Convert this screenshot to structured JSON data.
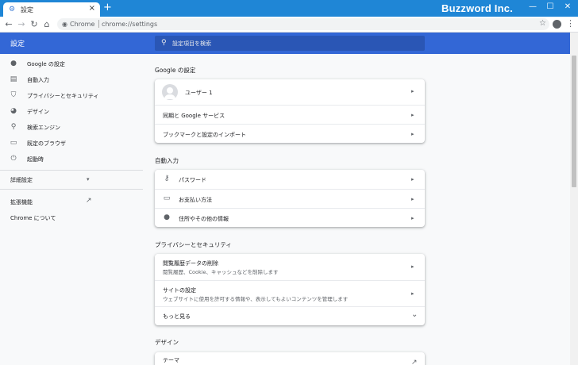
{
  "browser": {
    "tab_title": "設定",
    "tab_icon": "gear-icon",
    "tab_close": "×",
    "new_tab": "+",
    "brand": "Buzzword Inc.",
    "window_controls": [
      "—",
      "☐",
      "✕"
    ],
    "nav": {
      "back": "←",
      "forward": "→",
      "reload": "↻",
      "home": "⌂"
    },
    "omnibox": {
      "site_label": "Chrome",
      "url": "chrome://settings"
    },
    "star": "☆",
    "menu": "⋮"
  },
  "header": {
    "title": "設定",
    "search_placeholder": "設定項目を検索",
    "search_icon": "⚲"
  },
  "sidebar": {
    "items": [
      {
        "label": "Google の設定",
        "icon": "person-icon",
        "glyph": "●"
      },
      {
        "label": "自動入力",
        "icon": "clipboard-icon",
        "glyph": "▤"
      },
      {
        "label": "プライバシーとセキュリティ",
        "icon": "shield-icon",
        "glyph": "⛉"
      },
      {
        "label": "デザイン",
        "icon": "palette-icon",
        "glyph": "◕"
      },
      {
        "label": "検索エンジン",
        "icon": "search-icon",
        "glyph": "⚲"
      },
      {
        "label": "既定のブラウザ",
        "icon": "browser-icon",
        "glyph": "▭"
      },
      {
        "label": "起動時",
        "icon": "power-icon",
        "glyph": "⏻"
      }
    ],
    "advanced": "詳細設定",
    "advanced_caret": "▾",
    "extensions": "拡張機能",
    "extensions_icon": "↗",
    "about": "Chrome について"
  },
  "sections": {
    "google": {
      "title": "Google の設定",
      "user": "ユーザー 1",
      "sync": "同期と Google サービス",
      "import": "ブックマークと設定のインポート"
    },
    "autofill": {
      "title": "自動入力",
      "passwords": "パスワード",
      "passwords_glyph": "⚷",
      "payments": "お支払い方法",
      "payments_glyph": "▭",
      "addresses": "住所やその他の情報",
      "addresses_glyph": "●"
    },
    "privacy": {
      "title": "プライバシーとセキュリティ",
      "clear_title": "閲覧履歴データの削除",
      "clear_sub": "閲覧履歴、Cookie、キャッシュなどを削除します",
      "site_title": "サイトの設定",
      "site_sub": "ウェブサイトに使用を許可する情報や、表示してもよいコンテンツを管理します",
      "more": "もっと見る",
      "more_caret": "⌄"
    },
    "appearance": {
      "title": "デザイン",
      "theme": "テーマ",
      "theme_icon": "↗"
    }
  },
  "arrow": "▸"
}
